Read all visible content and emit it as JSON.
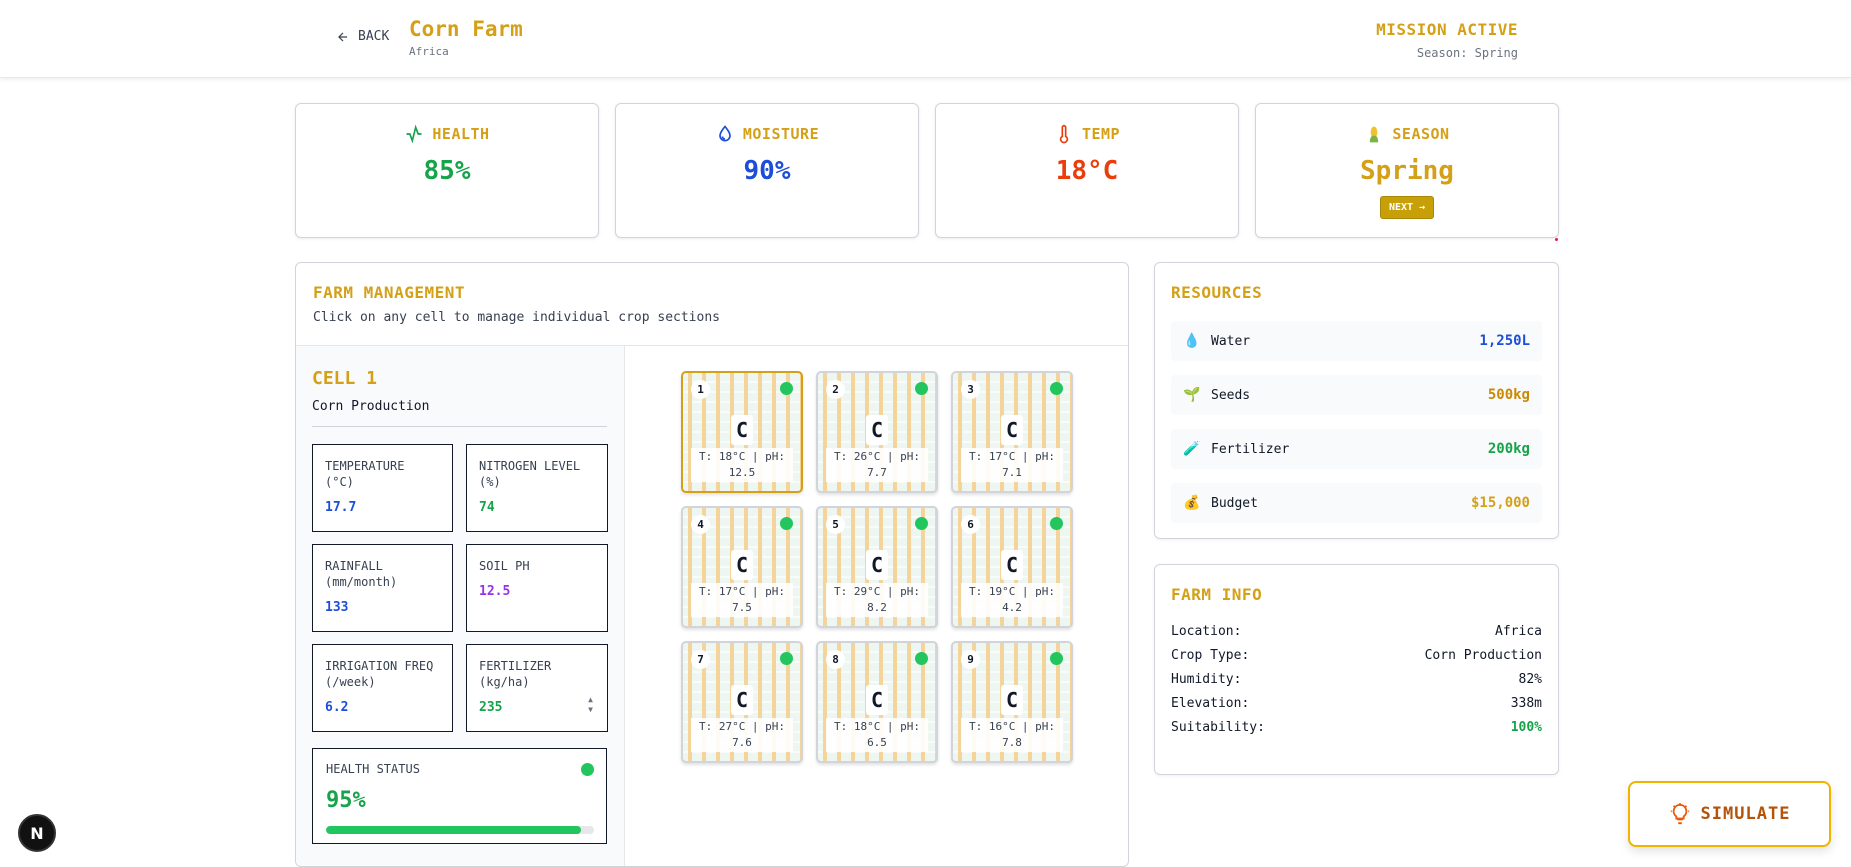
{
  "header": {
    "back_label": "BACK",
    "title": "Corn Farm",
    "subtitle": "Africa",
    "mission": "MISSION ACTIVE",
    "season_text": "Season: Spring"
  },
  "stats": [
    {
      "label": "HEALTH",
      "value": "85%",
      "color": "#16a34a",
      "icon": "activity-icon"
    },
    {
      "label": "MOISTURE",
      "value": "90%",
      "color": "#1d4ed8",
      "icon": "droplets-icon"
    },
    {
      "label": "TEMP",
      "value": "18°C",
      "color": "#ea3d0b",
      "icon": "thermometer-icon"
    },
    {
      "label": "SEASON",
      "value": "Spring",
      "color": "#d4a017",
      "icon": "corn-icon",
      "button": "NEXT →"
    }
  ],
  "management": {
    "title": "FARM MANAGEMENT",
    "subtitle": "Click on any cell to manage individual crop sections",
    "cell_title": "CELL 1",
    "cell_subtitle": "Corn Production",
    "metrics": [
      {
        "label": "TEMPERATURE (°C)",
        "value": "17.7",
        "color": "#1d4ed8"
      },
      {
        "label": "NITROGEN LEVEL (%)",
        "value": "74",
        "color": "#16a34a"
      },
      {
        "label": "RAINFALL (mm/month)",
        "value": "133",
        "color": "#1d4ed8"
      },
      {
        "label": "SOIL PH",
        "value": "12.5",
        "color": "#9333ea"
      },
      {
        "label": "IRRIGATION FREQ (/week)",
        "value": "6.2",
        "color": "#1d4ed8"
      },
      {
        "label": "FERTILIZER (kg/ha)",
        "value": "235",
        "color": "#16a34a"
      }
    ],
    "health_label": "HEALTH STATUS",
    "health_value": "95%",
    "health_fraction": 0.95
  },
  "cells": [
    {
      "num": "1",
      "letter": "C",
      "info": "T: 18°C | pH: 12.5",
      "selected": true
    },
    {
      "num": "2",
      "letter": "C",
      "info": "T: 26°C | pH: 7.7",
      "selected": false
    },
    {
      "num": "3",
      "letter": "C",
      "info": "T: 17°C | pH: 7.1",
      "selected": false
    },
    {
      "num": "4",
      "letter": "C",
      "info": "T: 17°C | pH: 7.5",
      "selected": false
    },
    {
      "num": "5",
      "letter": "C",
      "info": "T: 29°C | pH: 8.2",
      "selected": false
    },
    {
      "num": "6",
      "letter": "C",
      "info": "T: 19°C | pH: 4.2",
      "selected": false
    },
    {
      "num": "7",
      "letter": "C",
      "info": "T: 27°C | pH: 7.6",
      "selected": false
    },
    {
      "num": "8",
      "letter": "C",
      "info": "T: 18°C | pH: 6.5",
      "selected": false
    },
    {
      "num": "9",
      "letter": "C",
      "info": "T: 16°C | pH: 7.8",
      "selected": false
    }
  ],
  "resources": {
    "title": "RESOURCES",
    "items": [
      {
        "icon": "💧",
        "name": "Water",
        "value": "1,250L",
        "color": "#1d4ed8"
      },
      {
        "icon": "🌱",
        "name": "Seeds",
        "value": "500kg",
        "color": "#ca8a04"
      },
      {
        "icon": "🧪",
        "name": "Fertilizer",
        "value": "200kg",
        "color": "#16a34a"
      },
      {
        "icon": "💰",
        "name": "Budget",
        "value": "$15,000",
        "color": "#d4a017"
      }
    ]
  },
  "farm_info": {
    "title": "FARM INFO",
    "rows": [
      {
        "label": "Location:",
        "value": "Africa",
        "color": "#111827"
      },
      {
        "label": "Crop Type:",
        "value": "Corn Production",
        "color": "#111827"
      },
      {
        "label": "Humidity:",
        "value": "82%",
        "color": "#111827"
      },
      {
        "label": "Elevation:",
        "value": "338m",
        "color": "#111827"
      },
      {
        "label": "Suitability:",
        "value": "100%",
        "color": "#16a34a"
      }
    ]
  },
  "simulate_label": "SIMULATE",
  "badge_letter": "N"
}
